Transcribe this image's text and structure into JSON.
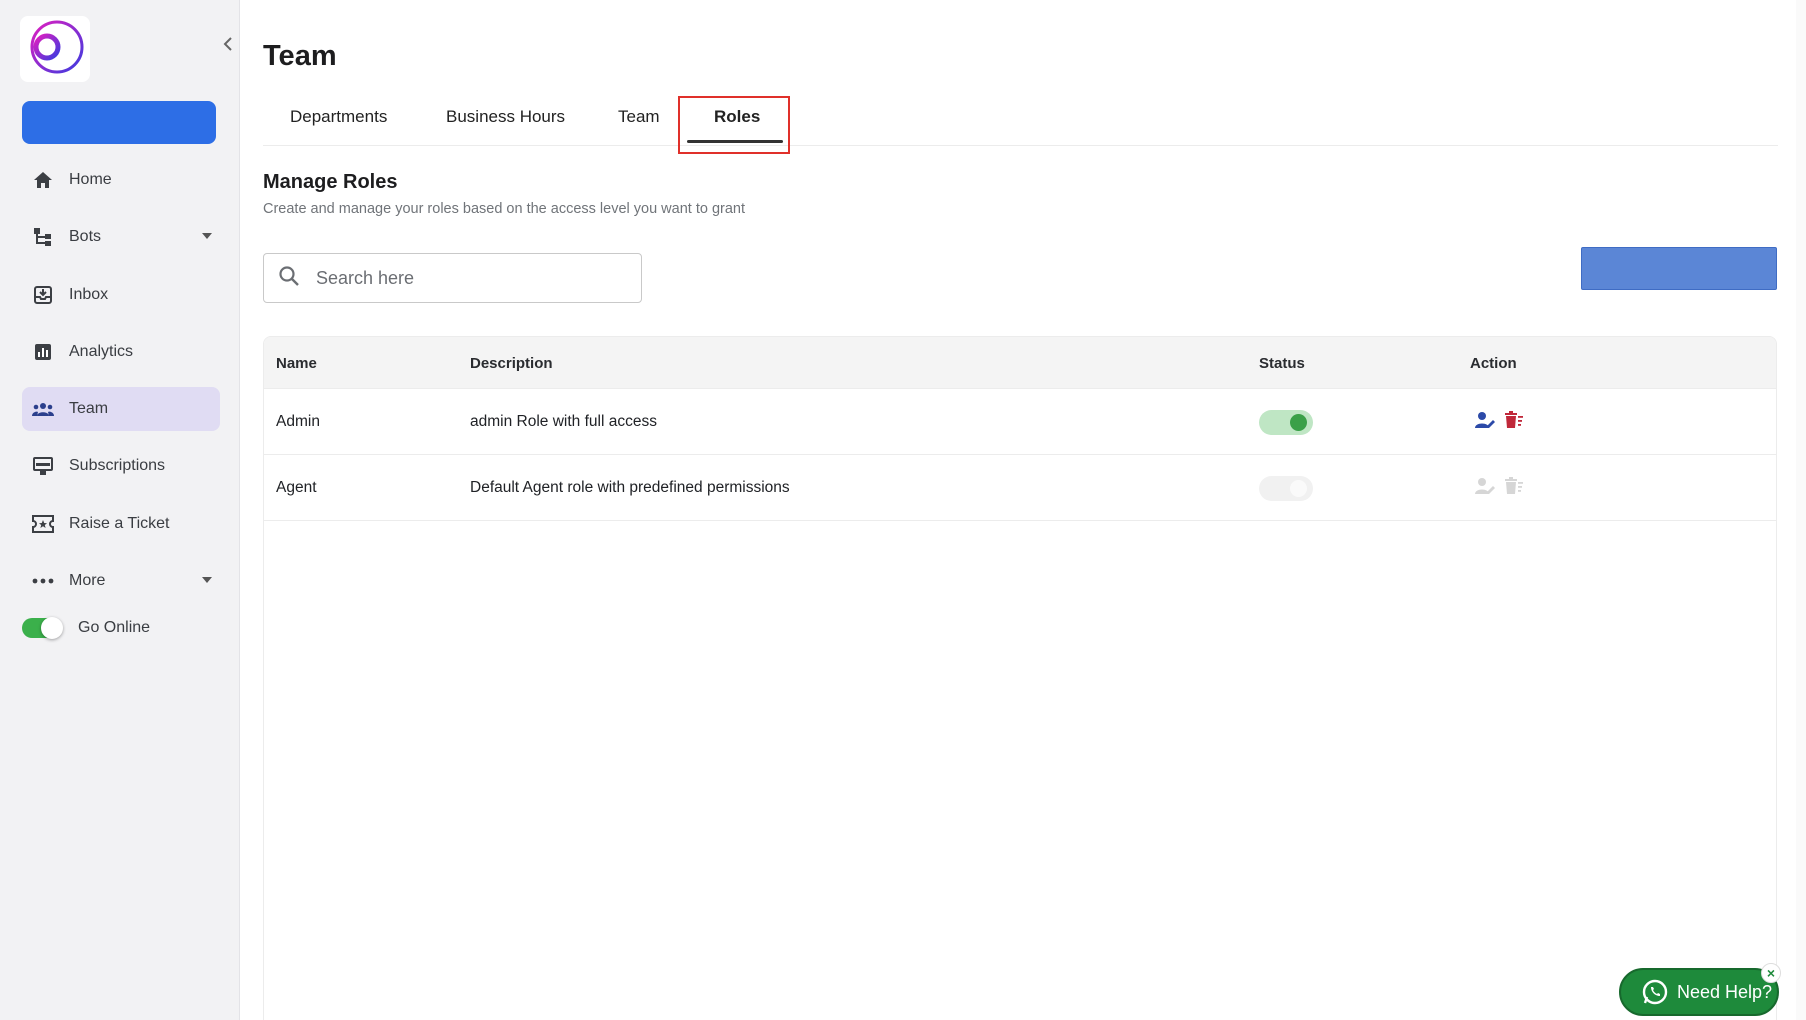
{
  "sidebar": {
    "logo_icon": "brand-logo-icon",
    "collapse_icon": "chevron-left-icon",
    "primary_button_label": "",
    "items": [
      {
        "label": "Home",
        "icon": "home-icon",
        "active": false,
        "has_caret": false
      },
      {
        "label": "Bots",
        "icon": "bots-icon",
        "active": false,
        "has_caret": true
      },
      {
        "label": "Inbox",
        "icon": "inbox-icon",
        "active": false,
        "has_caret": false
      },
      {
        "label": "Analytics",
        "icon": "analytics-icon",
        "active": false,
        "has_caret": false
      },
      {
        "label": "Team",
        "icon": "team-icon",
        "active": true,
        "has_caret": false
      },
      {
        "label": "Subscriptions",
        "icon": "subscriptions-icon",
        "active": false,
        "has_caret": false
      },
      {
        "label": "Raise a Ticket",
        "icon": "ticket-icon",
        "active": false,
        "has_caret": false
      },
      {
        "label": "More",
        "icon": "more-icon",
        "active": false,
        "has_caret": true
      }
    ],
    "go_online": {
      "label": "Go Online",
      "enabled": true
    }
  },
  "page": {
    "title": "Team",
    "tabs": [
      {
        "label": "Departments",
        "active": false
      },
      {
        "label": "Business Hours",
        "active": false
      },
      {
        "label": "Team",
        "active": false
      },
      {
        "label": "Roles",
        "active": true
      }
    ]
  },
  "roles": {
    "title": "Manage Roles",
    "subtitle": "Create and manage your roles based on the access level you want to grant",
    "search": {
      "placeholder": "Search here",
      "value": ""
    },
    "add_button_label": "",
    "table": {
      "columns": [
        "Name",
        "Description",
        "Status",
        "Action"
      ],
      "rows": [
        {
          "name": "Admin",
          "description": "admin Role with full access",
          "status": true,
          "actions_enabled": true
        },
        {
          "name": "Agent",
          "description": "Default Agent role with predefined permissions",
          "status": false,
          "actions_enabled": false
        }
      ]
    }
  },
  "help_widget": {
    "label": "Need Help?",
    "close": "×"
  },
  "colors": {
    "accent": "#2d6ee6",
    "active_nav": "#e0dcf3",
    "toggle_on": "#3aa048",
    "delete": "#c0283a",
    "edit": "#2c4aa8",
    "help": "#1e8a3b",
    "highlight": "#e0302a"
  }
}
